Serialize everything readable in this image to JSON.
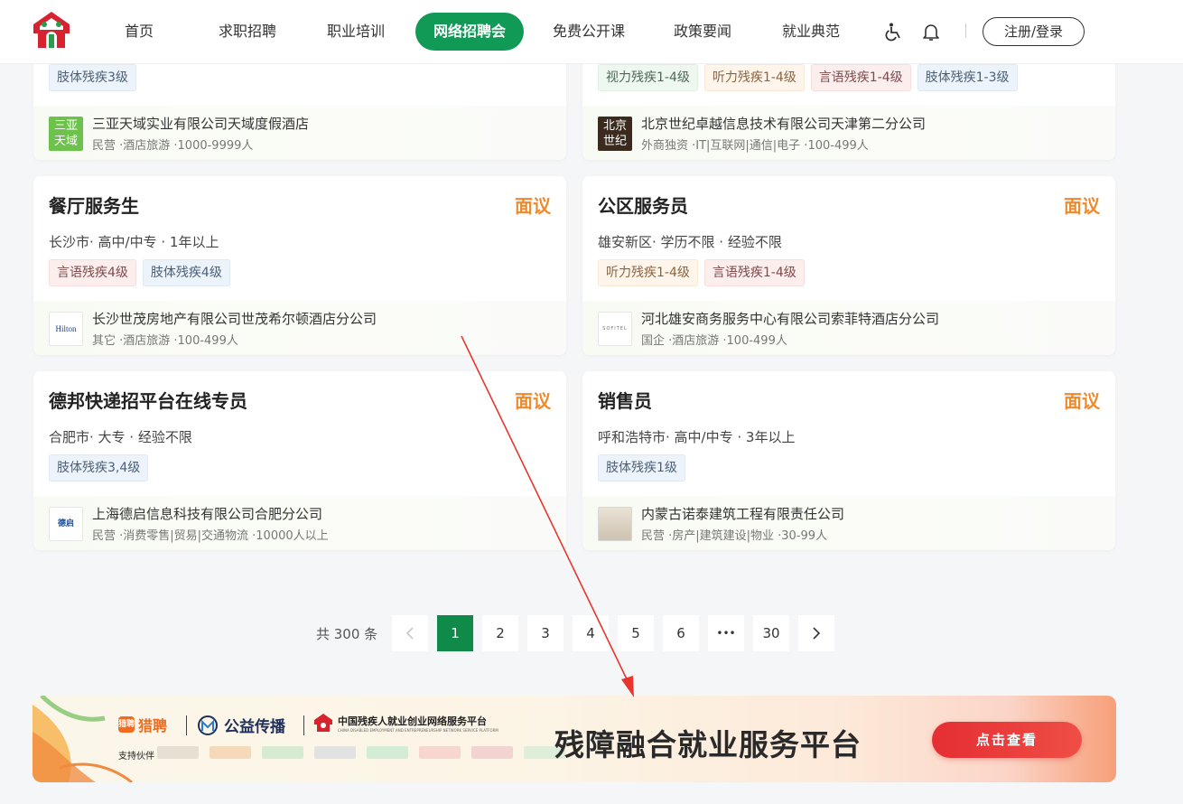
{
  "header": {
    "nav": [
      {
        "label": "首页"
      },
      {
        "label": "求职招聘"
      },
      {
        "label": "职业培训"
      },
      {
        "label": "网络招聘会",
        "active": true
      },
      {
        "label": "免费公开课"
      },
      {
        "label": "政策要闻"
      },
      {
        "label": "就业典范"
      }
    ],
    "accessibility_icon": "wheelchair-icon",
    "notification_icon": "bell-icon",
    "login_label": "注册/登录"
  },
  "cards": [
    {
      "title": "",
      "salary": "",
      "meta": "",
      "tags": [
        {
          "text": "肢体残疾3级",
          "style": "blue"
        }
      ],
      "company": {
        "name": "三亚天域实业有限公司天域度假酒店",
        "info": "民营 ·酒店旅游 ·1000-9999人",
        "logo_text": "三亚天域"
      }
    },
    {
      "title": "",
      "salary": "",
      "meta": "",
      "tags": [
        {
          "text": "视力残疾1-4级",
          "style": "green"
        },
        {
          "text": "听力残疾1-4级",
          "style": "orange"
        },
        {
          "text": "言语残疾1-4级",
          "style": "pink"
        },
        {
          "text": "肢体残疾1-3级",
          "style": "blue"
        }
      ],
      "company": {
        "name": "北京世纪卓越信息技术有限公司天津第二分公司",
        "info": "外商独资 ·IT|互联网|通信|电子 ·100-499人",
        "logo_text": "北京世纪"
      }
    },
    {
      "title": "餐厅服务生",
      "salary": "面议",
      "meta": "长沙市· 高中/中专 · 1年以上",
      "tags": [
        {
          "text": "言语残疾4级",
          "style": "pink"
        },
        {
          "text": "肢体残疾4级",
          "style": "blue"
        }
      ],
      "company": {
        "name": "长沙世茂房地产有限公司世茂希尔顿酒店分公司",
        "info": "其它 ·酒店旅游 ·100-499人",
        "logo_text": "Hilton"
      }
    },
    {
      "title": "公区服务员",
      "salary": "面议",
      "meta": "雄安新区· 学历不限 · 经验不限",
      "tags": [
        {
          "text": "听力残疾1-4级",
          "style": "orange"
        },
        {
          "text": "言语残疾1-4级",
          "style": "pink"
        }
      ],
      "company": {
        "name": "河北雄安商务服务中心有限公司索菲特酒店分公司",
        "info": "国企 ·酒店旅游 ·100-499人",
        "logo_text": "SOFITEL"
      }
    },
    {
      "title": "德邦快递招平台在线专员",
      "salary": "面议",
      "meta": "合肥市· 大专 · 经验不限",
      "tags": [
        {
          "text": "肢体残疾3,4级",
          "style": "blue"
        }
      ],
      "company": {
        "name": "上海德启信息科技有限公司合肥分公司",
        "info": "民营 ·消费零售|贸易|交通物流 ·10000人以上",
        "logo_text": "德启"
      }
    },
    {
      "title": "销售员",
      "salary": "面议",
      "meta": "呼和浩特市· 高中/中专 · 3年以上",
      "tags": [
        {
          "text": "肢体残疾1级",
          "style": "blue"
        }
      ],
      "company": {
        "name": "内蒙古诺泰建筑工程有限责任公司",
        "info": "民营 ·房产|建筑建设|物业 ·30-99人",
        "logo_text": ""
      }
    }
  ],
  "pagination": {
    "total_label": "共 300 条",
    "prev_icon": "chevron-left-icon",
    "next_icon": "chevron-right-icon",
    "pages": [
      "1",
      "2",
      "3",
      "4",
      "5",
      "6",
      "•••",
      "30"
    ],
    "current": "1"
  },
  "banner": {
    "liepin": "猎聘",
    "liepin_badge": "猎聘",
    "gongyi": "公益传播",
    "platform_title": "中国残疾人就业创业网络服务平台",
    "platform_en": "CHINA DISABLED EMPLOYMENT AND ENTREPRENEURSHIP NETWORK SERVICE PLATFORM",
    "support_label": "支持伙伴",
    "slogan": "残障融合就业服务平台",
    "cta": "点击查看"
  },
  "colors": {
    "brand_green": "#109a55",
    "salary_orange": "#ef8a2d",
    "annotation_red": "#e8362e"
  }
}
